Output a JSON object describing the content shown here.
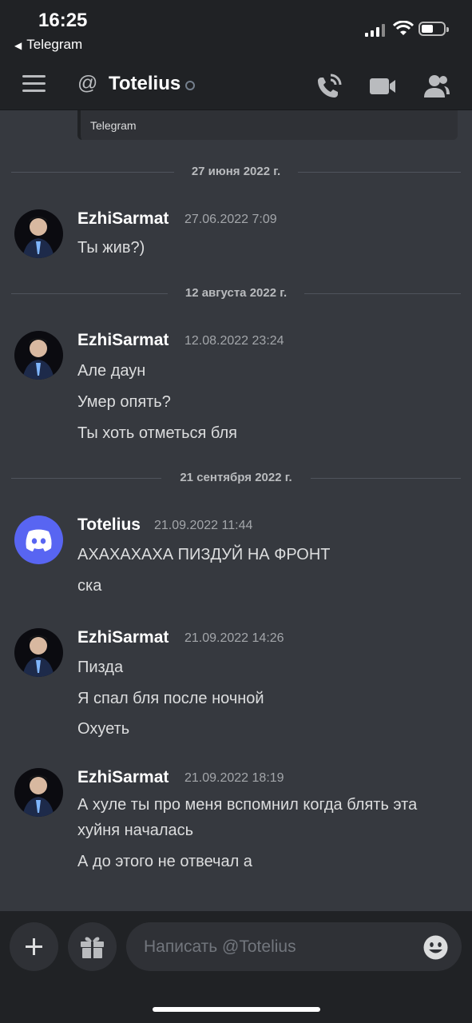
{
  "status_bar": {
    "time": "16:25",
    "back_app": "Telegram"
  },
  "header": {
    "title": "Totelius"
  },
  "embed": {
    "text": "Telegram"
  },
  "dividers": [
    "27 июня 2022 г.",
    "12 августа 2022 г.",
    "21 сентября 2022 г."
  ],
  "messages": [
    {
      "author": "EzhiSarmat",
      "timestamp": "27.06.2022 7:09",
      "lines": [
        "Ты жив?)"
      ]
    },
    {
      "author": "EzhiSarmat",
      "timestamp": "12.08.2022 23:24",
      "lines": [
        "Але даун",
        "Умер опять?",
        "Ты хоть отметься бля"
      ]
    },
    {
      "author": "Totelius",
      "timestamp": "21.09.2022 11:44",
      "lines": [
        "АХАХАХАХА ПИЗДУЙ НА ФРОНТ",
        "ска"
      ]
    },
    {
      "author": "EzhiSarmat",
      "timestamp": "21.09.2022 14:26",
      "lines": [
        "Пизда",
        "Я спал бля после ночной",
        "Охуеть"
      ]
    },
    {
      "author": "EzhiSarmat",
      "timestamp": "21.09.2022 18:19",
      "lines": [
        "А хуле ты про меня вспомнил когда блять эта хуйня началась",
        "А до этого не отвечал а"
      ]
    }
  ],
  "composer": {
    "placeholder": "Написать @Totelius"
  },
  "icons": {
    "menu": "hamburger-icon",
    "at": "at-icon",
    "call": "phone-icon",
    "video": "video-camera-icon",
    "members": "members-icon",
    "add": "plus-icon",
    "gift": "gift-icon",
    "emoji": "emoji-icon"
  },
  "colors": {
    "background": "#36393f",
    "header": "#202225",
    "blurple": "#5865f2",
    "text": "#dcddde",
    "muted": "#a3a6aa"
  }
}
